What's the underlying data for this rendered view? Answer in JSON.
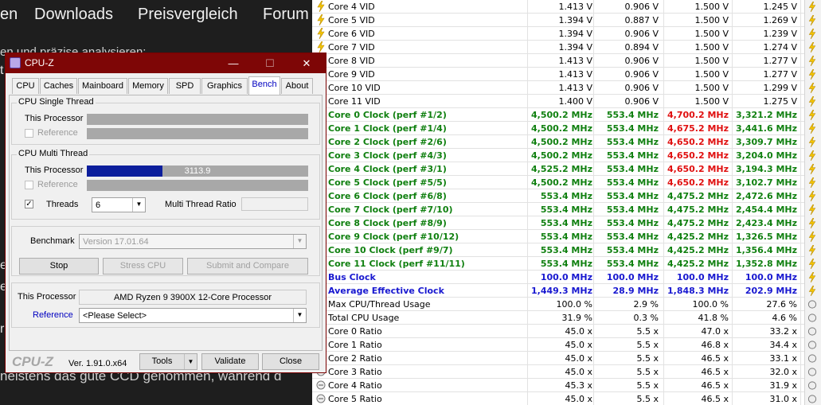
{
  "website": {
    "nav": [
      "en",
      "Downloads",
      "Preisvergleich",
      "Forum"
    ],
    "snippet_top": "en und präzise analysieren:",
    "snippet_bottom": "neistens das gute CCD genommen, während d",
    "side_chars": [
      "t",
      "e",
      "e",
      "r"
    ]
  },
  "cpuz": {
    "title": "CPU-Z",
    "tabs": [
      "CPU",
      "Caches",
      "Mainboard",
      "Memory",
      "SPD",
      "Graphics",
      "Bench",
      "About"
    ],
    "active_tab": "Bench",
    "single_thread": {
      "group_label": "CPU Single Thread",
      "this_processor_label": "This Processor",
      "reference_label": "Reference"
    },
    "multi_thread": {
      "group_label": "CPU Multi Thread",
      "this_processor_label": "This Processor",
      "this_processor_score": "3113.9",
      "this_processor_fill": 0.34,
      "reference_label": "Reference",
      "threads_label": "Threads",
      "threads_value": "6",
      "threads_checked": true,
      "ratio_label": "Multi Thread Ratio"
    },
    "benchmark": {
      "label": "Benchmark",
      "version": "Version 17.01.64",
      "stop_button": "Stop",
      "stress_button": "Stress CPU",
      "submit_button": "Submit and Compare"
    },
    "processor": {
      "this_processor_label": "This Processor",
      "this_processor_value": "AMD Ryzen 9 3900X 12-Core Processor",
      "reference_label": "Reference",
      "reference_value": "<Please Select>"
    },
    "footer": {
      "brand": "CPU-Z",
      "version": "Ver. 1.91.0.x64",
      "tools_button": "Tools",
      "validate_button": "Validate",
      "close_button": "Close"
    }
  },
  "hwinfo": {
    "rows": [
      {
        "name": "Core 4 VID",
        "values": [
          "1.413 V",
          "0.906 V",
          "1.500 V",
          "1.245 V"
        ],
        "style": "normal",
        "icon": "bolt-icon"
      },
      {
        "name": "Core 5 VID",
        "values": [
          "1.394 V",
          "0.887 V",
          "1.500 V",
          "1.269 V"
        ],
        "style": "normal",
        "icon": "bolt-icon"
      },
      {
        "name": "Core 6 VID",
        "values": [
          "1.394 V",
          "0.906 V",
          "1.500 V",
          "1.239 V"
        ],
        "style": "normal",
        "icon": "bolt-icon"
      },
      {
        "name": "Core 7 VID",
        "values": [
          "1.394 V",
          "0.894 V",
          "1.500 V",
          "1.274 V"
        ],
        "style": "normal",
        "icon": "bolt-icon"
      },
      {
        "name": "Core 8 VID",
        "values": [
          "1.413 V",
          "0.906 V",
          "1.500 V",
          "1.277 V"
        ],
        "style": "normal",
        "icon": "bolt-icon"
      },
      {
        "name": "Core 9 VID",
        "values": [
          "1.413 V",
          "0.906 V",
          "1.500 V",
          "1.277 V"
        ],
        "style": "normal",
        "icon": "bolt-icon"
      },
      {
        "name": "Core 10 VID",
        "values": [
          "1.413 V",
          "0.906 V",
          "1.500 V",
          "1.299 V"
        ],
        "style": "normal",
        "icon": "bolt-icon"
      },
      {
        "name": "Core 11 VID",
        "values": [
          "1.400 V",
          "0.906 V",
          "1.500 V",
          "1.275 V"
        ],
        "style": "normal",
        "icon": "bolt-icon"
      },
      {
        "name": "Core 0 Clock (perf #1/2)",
        "values": [
          "4,500.2 MHz",
          "553.4 MHz",
          "4,700.2 MHz",
          "3,321.2 MHz"
        ],
        "style": "green",
        "max_red": true,
        "icon": "clock-icon"
      },
      {
        "name": "Core 1 Clock (perf #1/4)",
        "values": [
          "4,500.2 MHz",
          "553.4 MHz",
          "4,675.2 MHz",
          "3,441.6 MHz"
        ],
        "style": "green",
        "max_red": true,
        "icon": "clock-icon"
      },
      {
        "name": "Core 2 Clock (perf #2/6)",
        "values": [
          "4,500.2 MHz",
          "553.4 MHz",
          "4,650.2 MHz",
          "3,309.7 MHz"
        ],
        "style": "green",
        "max_red": true,
        "icon": "clock-icon"
      },
      {
        "name": "Core 3 Clock (perf #4/3)",
        "values": [
          "4,500.2 MHz",
          "553.4 MHz",
          "4,650.2 MHz",
          "3,204.0 MHz"
        ],
        "style": "green",
        "max_red": true,
        "icon": "clock-icon"
      },
      {
        "name": "Core 4 Clock (perf #3/1)",
        "values": [
          "4,525.2 MHz",
          "553.4 MHz",
          "4,650.2 MHz",
          "3,194.3 MHz"
        ],
        "style": "green",
        "max_red": true,
        "icon": "clock-icon"
      },
      {
        "name": "Core 5 Clock (perf #5/5)",
        "values": [
          "4,500.2 MHz",
          "553.4 MHz",
          "4,650.2 MHz",
          "3,102.7 MHz"
        ],
        "style": "green",
        "max_red": true,
        "icon": "clock-icon"
      },
      {
        "name": "Core 6 Clock (perf #6/8)",
        "values": [
          "553.4 MHz",
          "553.4 MHz",
          "4,475.2 MHz",
          "2,472.6 MHz"
        ],
        "style": "green",
        "icon": "clock-icon"
      },
      {
        "name": "Core 7 Clock (perf #7/10)",
        "values": [
          "553.4 MHz",
          "553.4 MHz",
          "4,475.2 MHz",
          "2,454.4 MHz"
        ],
        "style": "green",
        "icon": "clock-icon"
      },
      {
        "name": "Core 8 Clock (perf #8/9)",
        "values": [
          "553.4 MHz",
          "553.4 MHz",
          "4,475.2 MHz",
          "2,423.4 MHz"
        ],
        "style": "green",
        "icon": "clock-icon"
      },
      {
        "name": "Core 9 Clock (perf #10/12)",
        "values": [
          "553.4 MHz",
          "553.4 MHz",
          "4,425.2 MHz",
          "1,326.5 MHz"
        ],
        "style": "green",
        "icon": "clock-icon"
      },
      {
        "name": "Core 10 Clock (perf #9/7)",
        "values": [
          "553.4 MHz",
          "553.4 MHz",
          "4,425.2 MHz",
          "1,356.4 MHz"
        ],
        "style": "green",
        "icon": "clock-icon"
      },
      {
        "name": "Core 11 Clock (perf #11/11)",
        "values": [
          "553.4 MHz",
          "553.4 MHz",
          "4,425.2 MHz",
          "1,352.8 MHz"
        ],
        "style": "green",
        "icon": "clock-icon"
      },
      {
        "name": "Bus Clock",
        "values": [
          "100.0 MHz",
          "100.0 MHz",
          "100.0 MHz",
          "100.0 MHz"
        ],
        "style": "blue",
        "icon": "clock-icon"
      },
      {
        "name": "Average Effective Clock",
        "values": [
          "1,449.3 MHz",
          "28.9 MHz",
          "1,848.3 MHz",
          "202.9 MHz"
        ],
        "style": "blue",
        "icon": "clock-icon"
      },
      {
        "name": "Max CPU/Thread Usage",
        "values": [
          "100.0 %",
          "2.9 %",
          "100.0 %",
          "27.6 %"
        ],
        "style": "normal",
        "icon": "usage-icon"
      },
      {
        "name": "Total CPU Usage",
        "values": [
          "31.9 %",
          "0.3 %",
          "41.8 %",
          "4.6 %"
        ],
        "style": "normal",
        "icon": "usage-icon"
      },
      {
        "name": "Core 0 Ratio",
        "values": [
          "45.0 x",
          "5.5 x",
          "47.0 x",
          "33.2 x"
        ],
        "style": "normal",
        "icon": "ratio-icon"
      },
      {
        "name": "Core 1 Ratio",
        "values": [
          "45.0 x",
          "5.5 x",
          "46.8 x",
          "34.4 x"
        ],
        "style": "normal",
        "icon": "ratio-icon"
      },
      {
        "name": "Core 2 Ratio",
        "values": [
          "45.0 x",
          "5.5 x",
          "46.5 x",
          "33.1 x"
        ],
        "style": "normal",
        "icon": "ratio-icon"
      },
      {
        "name": "Core 3 Ratio",
        "values": [
          "45.0 x",
          "5.5 x",
          "46.5 x",
          "32.0 x"
        ],
        "style": "normal",
        "icon": "ratio-icon"
      },
      {
        "name": "Core 4 Ratio",
        "values": [
          "45.3 x",
          "5.5 x",
          "46.5 x",
          "31.9 x"
        ],
        "style": "normal",
        "icon": "ratio-icon"
      },
      {
        "name": "Core 5 Ratio",
        "values": [
          "45.0 x",
          "5.5 x",
          "46.5 x",
          "31.0 x"
        ],
        "style": "normal",
        "icon": "ratio-icon"
      }
    ]
  }
}
